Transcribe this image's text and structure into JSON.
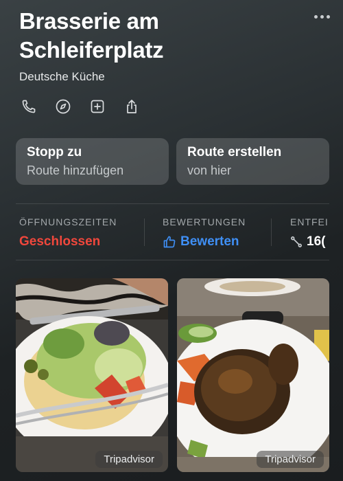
{
  "place": {
    "name": "Brasserie am Schleiferplatz",
    "category": "Deutsche Küche"
  },
  "actions": [
    {
      "icon": "phone-icon"
    },
    {
      "icon": "compass-icon"
    },
    {
      "icon": "add-to-guide-icon"
    },
    {
      "icon": "share-icon"
    }
  ],
  "buttons": {
    "stop": {
      "title": "Stopp zu",
      "subtitle": "Route hinzufügen"
    },
    "route": {
      "title": "Route erstellen",
      "subtitle": "von hier"
    }
  },
  "info": {
    "hours": {
      "label": "ÖFFNUNGSZEITEN",
      "value": "Geschlossen"
    },
    "ratings": {
      "label": "BEWERTUNGEN",
      "value": "Bewerten"
    },
    "distance": {
      "label": "ENTFEI",
      "value": "16("
    }
  },
  "photos": [
    {
      "source": "Tripadvisor"
    },
    {
      "source": "Tripadvisor"
    }
  ],
  "colors": {
    "closed": "#f0473c",
    "accent": "#3f8ff5"
  }
}
